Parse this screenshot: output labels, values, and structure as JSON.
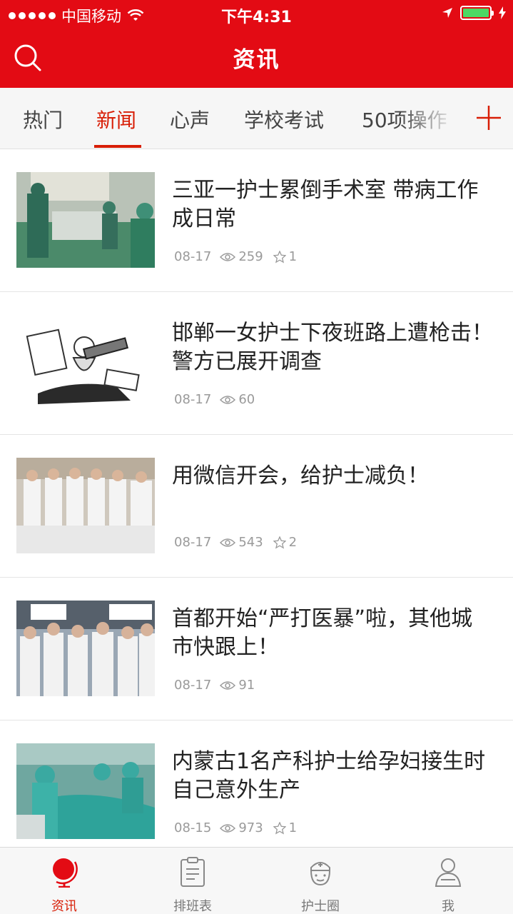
{
  "status_bar": {
    "carrier": "中国移动",
    "time": "下午4:31"
  },
  "header": {
    "title": "资讯",
    "search_icon": "search-icon"
  },
  "tabs": [
    {
      "label": "热门",
      "active": false
    },
    {
      "label": "新闻",
      "active": true
    },
    {
      "label": "心声",
      "active": false
    },
    {
      "label": "学校考试",
      "active": false
    },
    {
      "label": "50项操作",
      "active": false
    }
  ],
  "news": [
    {
      "title": "三亚一护士累倒手术室 带病工作成日常",
      "date": "08-17",
      "views": "259",
      "stars": "1"
    },
    {
      "title": "邯郸一女护士下夜班路上遭枪击！警方已展开调查",
      "date": "08-17",
      "views": "60"
    },
    {
      "title": "用微信开会，给护士减负！",
      "date": "08-17",
      "views": "543",
      "stars": "2"
    },
    {
      "title": "首都开始“严打医暴”啦，其他城市快跟上！",
      "date": "08-17",
      "views": "91"
    },
    {
      "title": "内蒙古1名产科护士给孕妇接生时自己意外生产",
      "date": "08-15",
      "views": "973",
      "stars": "1"
    }
  ],
  "tabbar": [
    {
      "label": "资讯",
      "icon": "globe-icon",
      "active": true
    },
    {
      "label": "排班表",
      "icon": "clipboard-icon",
      "active": false
    },
    {
      "label": "护士圈",
      "icon": "nurse-icon",
      "active": false
    },
    {
      "label": "我",
      "icon": "user-icon",
      "active": false
    }
  ],
  "colors": {
    "brand_red": "#e30b14",
    "active_tab": "#d81e06"
  }
}
